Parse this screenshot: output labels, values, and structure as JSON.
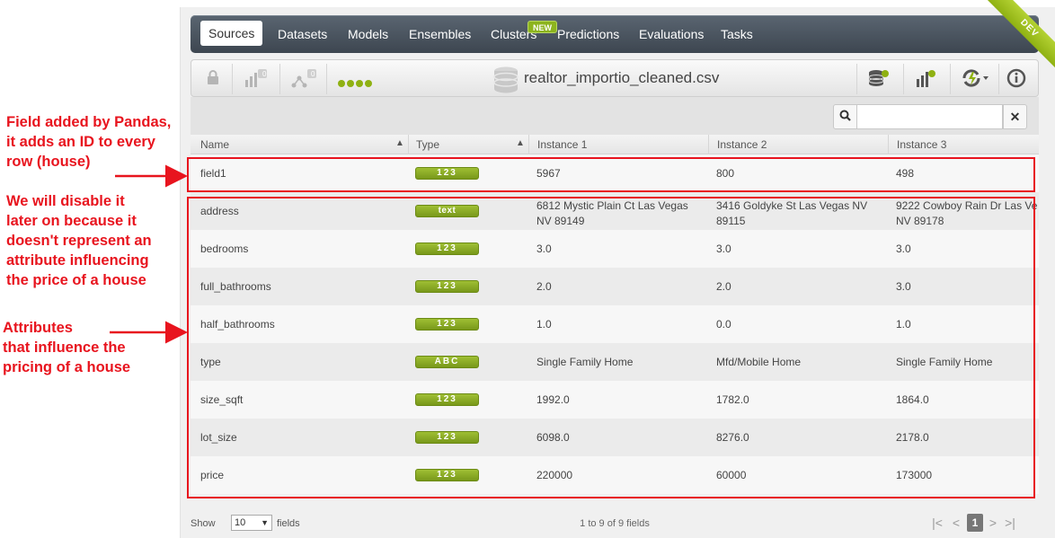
{
  "nav": {
    "tabs": [
      "Sources",
      "Datasets",
      "Models",
      "Ensembles",
      "Clusters",
      "Predictions",
      "Evaluations",
      "Tasks"
    ],
    "new_badge": "NEW",
    "env_ribbon": "DEV"
  },
  "toolbar": {
    "filename": "realtor_importio_cleaned.csv",
    "datasets_count": "0",
    "models_count": "0"
  },
  "table": {
    "headers": [
      "Name",
      "Type",
      "Instance 1",
      "Instance 2",
      "Instance 3"
    ],
    "rows": [
      {
        "name": "field1",
        "type": "123",
        "i1": "5967",
        "i2": "800",
        "i3": "498"
      },
      {
        "name": "address",
        "type": "text",
        "i1": "6812 Mystic Plain Ct Las Vegas NV 89149",
        "i2": "3416 Goldyke St Las Vegas NV 89115",
        "i3": "9222 Cowboy Rain Dr Las Ve NV 89178"
      },
      {
        "name": "bedrooms",
        "type": "123",
        "i1": "3.0",
        "i2": "3.0",
        "i3": "3.0"
      },
      {
        "name": "full_bathrooms",
        "type": "123",
        "i1": "2.0",
        "i2": "2.0",
        "i3": "3.0"
      },
      {
        "name": "half_bathrooms",
        "type": "123",
        "i1": "1.0",
        "i2": "0.0",
        "i3": "1.0"
      },
      {
        "name": "type",
        "type": "ABC",
        "i1": "Single Family Home",
        "i2": "Mfd/Mobile Home",
        "i3": "Single Family Home"
      },
      {
        "name": "size_sqft",
        "type": "123",
        "i1": "1992.0",
        "i2": "1782.0",
        "i3": "1864.0"
      },
      {
        "name": "lot_size",
        "type": "123",
        "i1": "6098.0",
        "i2": "8276.0",
        "i3": "2178.0"
      },
      {
        "name": "price",
        "type": "123",
        "i1": "220000",
        "i2": "60000",
        "i3": "173000"
      }
    ]
  },
  "footer": {
    "show_label": "Show",
    "page_size": "10",
    "fields_label": "fields",
    "count": "1 to 9 of 9 fields",
    "current_page": "1"
  },
  "annotations": {
    "pandas_note": [
      "Field added by Pandas,",
      "it adds an ID to every",
      "row (house)"
    ],
    "disable_note": [
      "We will disable it",
      "later on because it",
      "doesn't represent an",
      "attribute influencing",
      "the price of a house"
    ],
    "attributes_note": [
      "Attributes",
      "that influence the",
      "pricing of a house"
    ]
  },
  "colors": {
    "annotation_red": "#e8141e",
    "badge_green": "#8fb112",
    "nav_dark": "#47515b"
  }
}
